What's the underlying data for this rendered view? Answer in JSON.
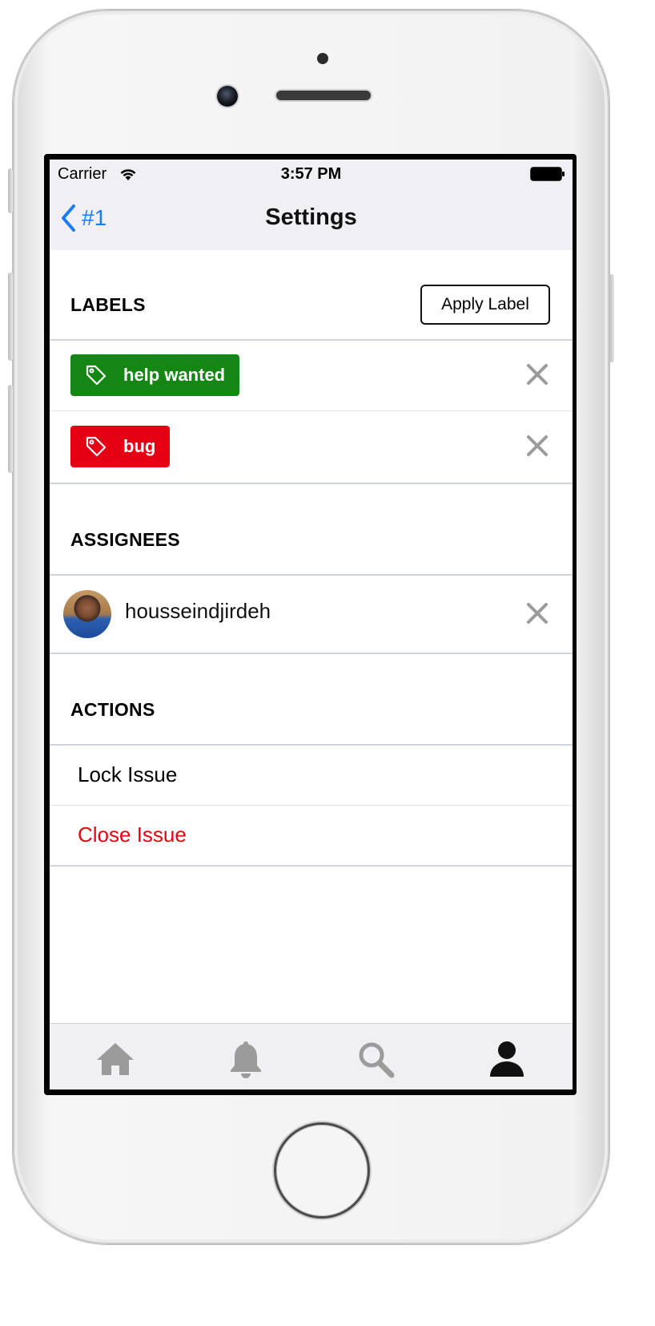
{
  "status_bar": {
    "carrier": "Carrier",
    "time": "3:57 PM",
    "icons": [
      "wifi-icon",
      "battery-icon"
    ]
  },
  "nav": {
    "back_label": "#1",
    "back_icon": "chevron-left-icon",
    "title": "Settings"
  },
  "labels_section": {
    "header": "LABELS",
    "apply_button": "Apply Label",
    "labels": [
      {
        "name": "help wanted",
        "color": "#138613",
        "icon": "tag-icon"
      },
      {
        "name": "bug",
        "color": "#e60013",
        "icon": "tag-icon"
      }
    ]
  },
  "assignees_section": {
    "header": "ASSIGNEES",
    "assignees": [
      {
        "username": "housseindjirdeh",
        "icon": "avatar"
      }
    ]
  },
  "actions_section": {
    "header": "ACTIONS",
    "items": [
      {
        "label": "Lock Issue",
        "color": "#000000"
      },
      {
        "label": "Close Issue",
        "color": "#e60013"
      }
    ]
  },
  "tab_bar": {
    "tabs": [
      {
        "icon": "home-icon",
        "active": false
      },
      {
        "icon": "bell-icon",
        "active": false
      },
      {
        "icon": "search-icon",
        "active": false
      },
      {
        "icon": "person-icon",
        "active": true
      }
    ]
  },
  "colors": {
    "accent": "#1a7cf5",
    "inactive_tab": "#9b9b9b",
    "active_tab": "#111111",
    "remove_icon": "#9b9b9b"
  }
}
